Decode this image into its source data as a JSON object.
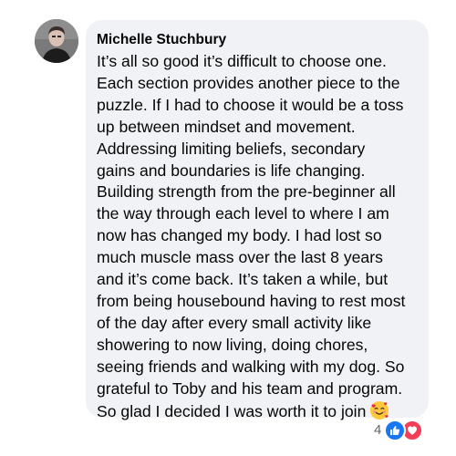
{
  "comment": {
    "author": "Michelle Stuchbury",
    "lines": [
      "It’s all so good it’s difficult to choose one.",
      "Each section provides another piece to the",
      "puzzle. If I had to choose it would be a toss",
      "up between mindset and movement.",
      "Addressing limiting beliefs, secondary",
      "gains and boundaries is life changing.",
      "Building strength from the pre-beginner all",
      "the way through each level to where I am",
      "now has changed my body.  I had lost so",
      "much muscle mass over the last 8 years",
      "and it’s come back. It’s taken a while, but",
      "from being housebound having to rest most",
      "of the day after every small activity like",
      "showering to now living, doing chores,",
      "seeing friends and walking with my dog. So",
      "grateful to Toby and his team and program.",
      "So glad I decided I was worth it to join"
    ],
    "trailing_emoji": "smiling-face-with-hearts-icon"
  },
  "reactions": {
    "count": "4",
    "types": [
      "like-icon",
      "love-icon"
    ],
    "colors": {
      "like": "#1877f2",
      "love": "#f33e58"
    }
  },
  "colors": {
    "bubble": "#f0f2f5",
    "text": "#050505",
    "meta": "#65676b"
  }
}
